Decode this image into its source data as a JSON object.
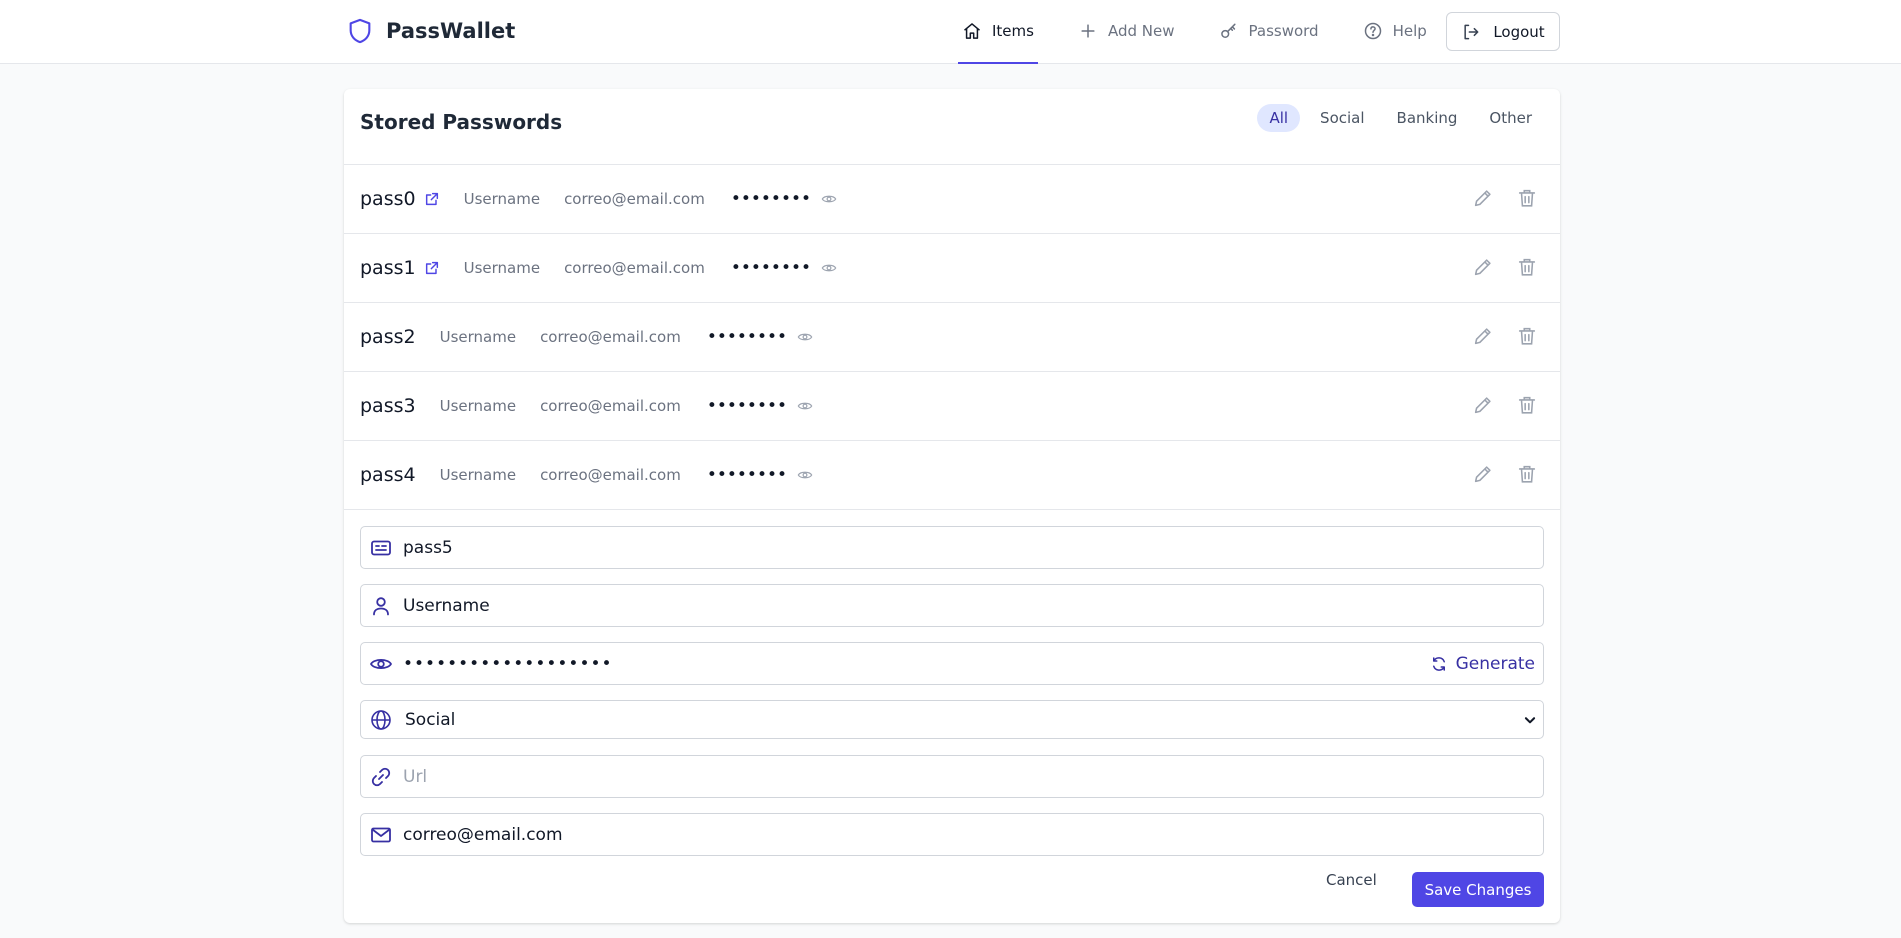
{
  "header": {
    "brand": "PassWallet",
    "nav": [
      {
        "label": "Items",
        "icon": "home-icon",
        "active": true
      },
      {
        "label": "Add New",
        "icon": "plus-icon"
      },
      {
        "label": "Password",
        "icon": "key-icon"
      },
      {
        "label": "Help",
        "icon": "help-circle-icon"
      }
    ],
    "logout_label": "Logout"
  },
  "main": {
    "title": "Stored Passwords",
    "filters": [
      "All",
      "Social",
      "Banking",
      "Other"
    ],
    "active_filter": "All",
    "entries": [
      {
        "name": "pass0",
        "username": "Username",
        "email": "correo@email.com",
        "password_mask": "••••••••",
        "has_link": true
      },
      {
        "name": "pass1",
        "username": "Username",
        "email": "correo@email.com",
        "password_mask": "••••••••",
        "has_link": true
      },
      {
        "name": "pass2",
        "username": "Username",
        "email": "correo@email.com",
        "password_mask": "••••••••",
        "has_link": false
      },
      {
        "name": "pass3",
        "username": "Username",
        "email": "correo@email.com",
        "password_mask": "••••••••",
        "has_link": false
      },
      {
        "name": "pass4",
        "username": "Username",
        "email": "correo@email.com",
        "password_mask": "••••••••",
        "has_link": false
      }
    ]
  },
  "form": {
    "name_value": "pass5",
    "username_value": "Username",
    "password_mask": "•••••••••••••••••••",
    "generate_label": "Generate",
    "category_value": "Social",
    "url_placeholder": "Url",
    "email_value": "correo@email.com",
    "cancel_label": "Cancel",
    "save_label": "Save Changes"
  },
  "colors": {
    "accent": "#4f46e5",
    "accent_text": "#3730a3",
    "active_filter_bg": "#e0e7ff",
    "icon_muted": "#9ca3af"
  }
}
